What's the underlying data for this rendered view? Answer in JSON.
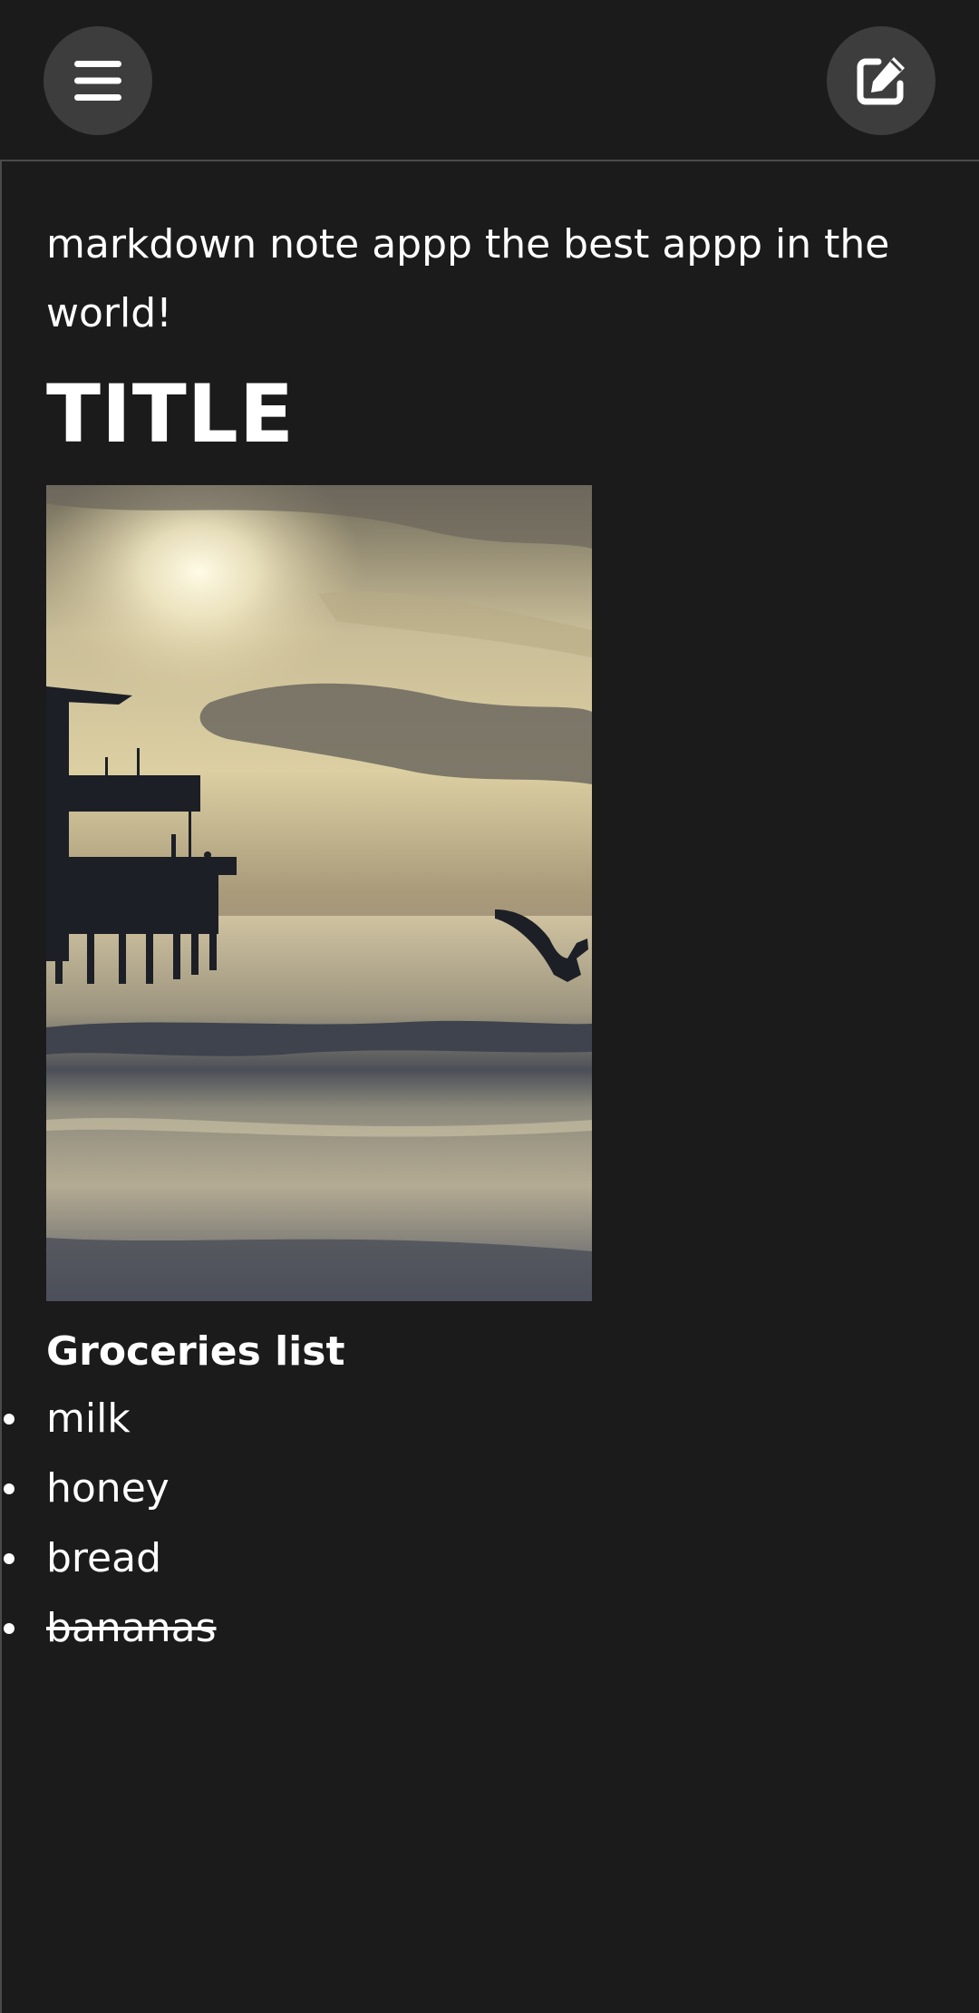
{
  "toolbar": {
    "menu_icon": "hamburger-menu-icon",
    "edit_icon": "edit-note-icon"
  },
  "note": {
    "intro": "markdown note appp the best appp in the world!",
    "title": "TITLE",
    "image_description_hidden": "",
    "list_heading": "Groceries list",
    "list_items": [
      {
        "text": "milk",
        "checked": false
      },
      {
        "text": "honey",
        "checked": false
      },
      {
        "text": "bread",
        "checked": false
      },
      {
        "text": "bananas",
        "checked": true
      }
    ]
  },
  "colors": {
    "background": "#1b1b1c",
    "button_background": "#3d3d3e",
    "divider": "#4a4a4b",
    "text": "#ffffff"
  }
}
